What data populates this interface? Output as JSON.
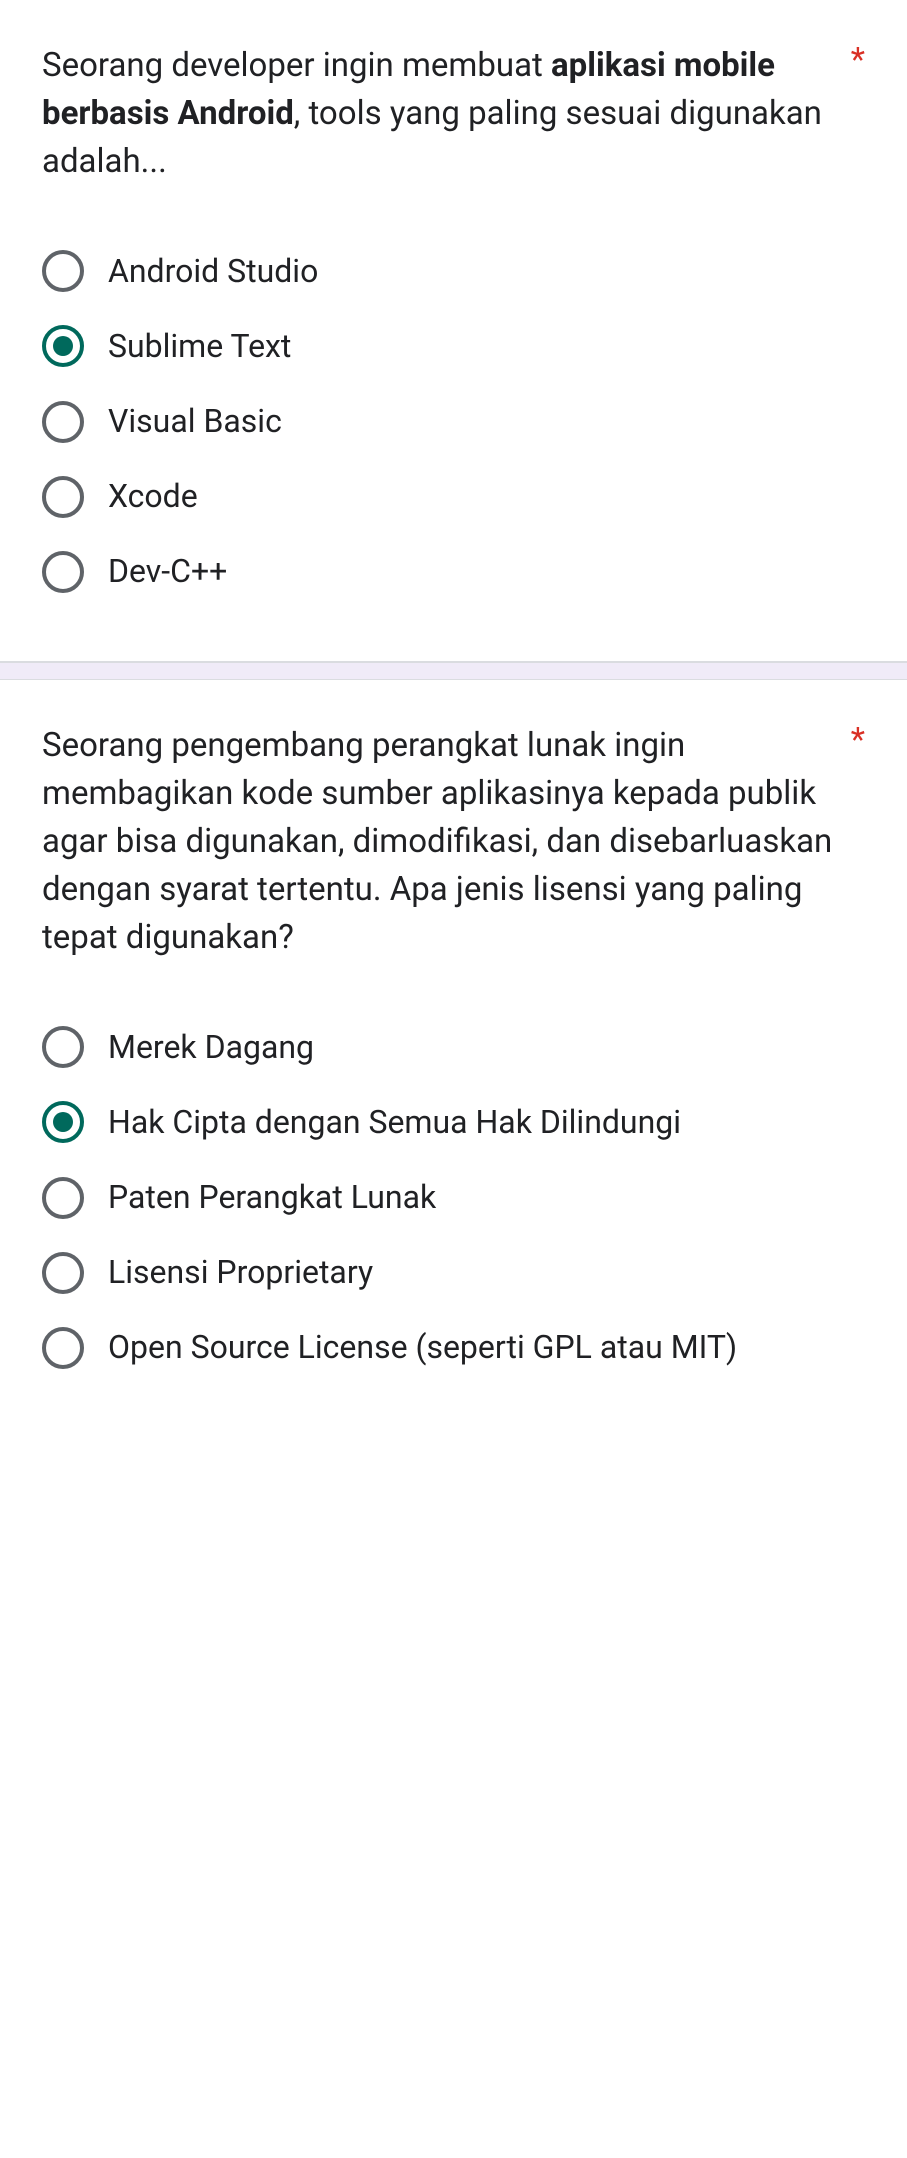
{
  "questions": [
    {
      "required_marker": "*",
      "text_pre": "Seorang developer ingin membuat ",
      "text_bold": "aplikasi mobile berbasis Android",
      "text_post": ", tools yang paling sesuai digunakan adalah...",
      "selected_index": 1,
      "options": [
        "Android Studio",
        "Sublime Text",
        "Visual Basic",
        "Xcode",
        "Dev-C++"
      ]
    },
    {
      "required_marker": "*",
      "text_pre": "Seorang pengembang perangkat lunak ingin membagikan kode sumber aplikasinya kepada publik agar bisa digunakan, dimodifikasi, dan disebarluaskan dengan syarat tertentu. Apa jenis lisensi yang paling tepat digunakan?",
      "text_bold": "",
      "text_post": "",
      "selected_index": 1,
      "options": [
        "Merek Dagang",
        "Hak Cipta dengan Semua Hak Dilindungi",
        "Paten Perangkat Lunak",
        "Lisensi Proprietary",
        "Open Source License (seperti GPL atau MIT)"
      ]
    }
  ]
}
